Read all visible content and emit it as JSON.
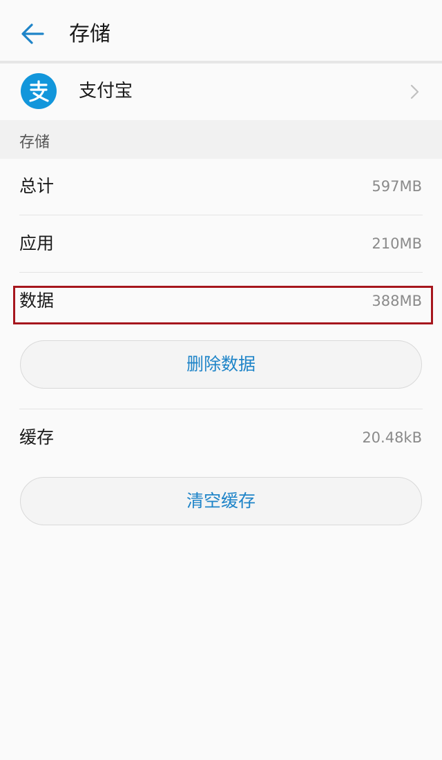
{
  "header": {
    "title": "存储"
  },
  "app": {
    "name": "支付宝",
    "icon": "alipay-icon",
    "icon_color": "#1296db"
  },
  "section": {
    "title": "存储"
  },
  "rows": {
    "total": {
      "label": "总计",
      "value": "597MB"
    },
    "app": {
      "label": "应用",
      "value": "210MB"
    },
    "data": {
      "label": "数据",
      "value": "388MB"
    },
    "cache": {
      "label": "缓存",
      "value": "20.48kB"
    }
  },
  "buttons": {
    "delete_data": "删除数据",
    "clear_cache": "清空缓存"
  },
  "colors": {
    "accent": "#1e84c8",
    "highlight": "#a6161d",
    "background": "#fafafa"
  }
}
